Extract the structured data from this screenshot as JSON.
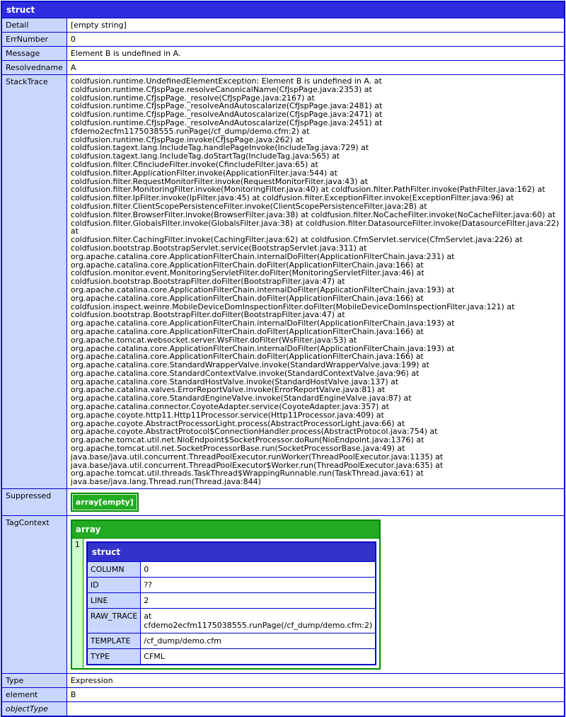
{
  "struct": {
    "title": "struct",
    "rows": {
      "detail": {
        "key": "Detail",
        "value": "[empty string]"
      },
      "errnumber": {
        "key": "ErrNumber",
        "value": "0"
      },
      "message": {
        "key": "Message",
        "value": "Element B is undefined in A."
      },
      "resolvedname": {
        "key": "Resolvedname",
        "value": "A"
      },
      "stacktrace": {
        "key": "StackTrace"
      },
      "suppressed": {
        "key": "Suppressed",
        "value": "array[empty]"
      },
      "tagcontext": {
        "key": "TagContext"
      },
      "type": {
        "key": "Type",
        "value": "Expression"
      },
      "element": {
        "key": "element",
        "value": "B"
      },
      "objecttype": {
        "key": "objectType"
      }
    },
    "stacktrace_lines": [
      "coldfusion.runtime.UndefinedElementException: Element B is undefined in A. at",
      "coldfusion.runtime.CfJspPage.resolveCanonicalName(CfJspPage.java:2353) at coldfusion.runtime.CfJspPage._resolve(CfJspPage.java:2167) at",
      "coldfusion.runtime.CfJspPage._resolveAndAutoscalarize(CfJspPage.java:2481) at",
      "coldfusion.runtime.CfJspPage._resolveAndAutoscalarize(CfJspPage.java:2471) at",
      "coldfusion.runtime.CfJspPage._resolveAndAutoscalarize(CfJspPage.java:2451) at cfdemo2ecfm1175038555.runPage(/cf_dump/demo.cfm:2) at",
      "coldfusion.runtime.CfJspPage.invoke(CfJspPage.java:262) at coldfusion.tagext.lang.IncludeTag.handlePageInvoke(IncludeTag.java:729) at",
      "coldfusion.tagext.lang.IncludeTag.doStartTag(IncludeTag.java:565) at coldfusion.filter.CfincludeFilter.invoke(CfincludeFilter.java:65) at",
      "coldfusion.filter.ApplicationFilter.invoke(ApplicationFilter.java:544) at coldfusion.filter.RequestMonitorFilter.invoke(RequestMonitorFilter.java:43) at",
      "coldfusion.filter.MonitoringFilter.invoke(MonitoringFilter.java:40) at coldfusion.filter.PathFilter.invoke(PathFilter.java:162) at",
      "coldfusion.filter.IpFilter.invoke(IpFilter.java:45) at coldfusion.filter.ExceptionFilter.invoke(ExceptionFilter.java:96) at",
      "coldfusion.filter.ClientScopePersistenceFilter.invoke(ClientScopePersistenceFilter.java:28) at",
      "coldfusion.filter.BrowserFilter.invoke(BrowserFilter.java:38) at coldfusion.filter.NoCacheFilter.invoke(NoCacheFilter.java:60) at",
      "coldfusion.filter.GlobalsFilter.invoke(GlobalsFilter.java:38) at coldfusion.filter.DatasourceFilter.invoke(DatasourceFilter.java:22) at",
      "coldfusion.filter.CachingFilter.invoke(CachingFilter.java:62) at coldfusion.CfmServlet.service(CfmServlet.java:226) at",
      "coldfusion.bootstrap.BootstrapServlet.service(BootstrapServlet.java:311) at",
      "org.apache.catalina.core.ApplicationFilterChain.internalDoFilter(ApplicationFilterChain.java:231) at",
      "org.apache.catalina.core.ApplicationFilterChain.doFilter(ApplicationFilterChain.java:166) at",
      "coldfusion.monitor.event.MonitoringServletFilter.doFilter(MonitoringServletFilter.java:46) at",
      "coldfusion.bootstrap.BootstrapFilter.doFilter(BootstrapFilter.java:47) at",
      "org.apache.catalina.core.ApplicationFilterChain.internalDoFilter(ApplicationFilterChain.java:193) at",
      "org.apache.catalina.core.ApplicationFilterChain.doFilter(ApplicationFilterChain.java:166) at",
      "coldfusion.inspect.weinre.MobileDeviceDomInspectionFilter.doFilter(MobileDeviceDomInspectionFilter.java:121) at",
      "coldfusion.bootstrap.BootstrapFilter.doFilter(BootstrapFilter.java:47) at",
      "org.apache.catalina.core.ApplicationFilterChain.internalDoFilter(ApplicationFilterChain.java:193) at",
      "org.apache.catalina.core.ApplicationFilterChain.doFilter(ApplicationFilterChain.java:166) at",
      "org.apache.tomcat.websocket.server.WsFilter.doFilter(WsFilter.java:53) at",
      "org.apache.catalina.core.ApplicationFilterChain.internalDoFilter(ApplicationFilterChain.java:193) at",
      "org.apache.catalina.core.ApplicationFilterChain.doFilter(ApplicationFilterChain.java:166) at",
      "org.apache.catalina.core.StandardWrapperValve.invoke(StandardWrapperValve.java:199) at",
      "org.apache.catalina.core.StandardContextValve.invoke(StandardContextValve.java:96) at",
      "org.apache.catalina.core.StandardHostValve.invoke(StandardHostValve.java:137) at",
      "org.apache.catalina.valves.ErrorReportValve.invoke(ErrorReportValve.java:81) at",
      "org.apache.catalina.core.StandardEngineValve.invoke(StandardEngineValve.java:87) at",
      "org.apache.catalina.connector.CoyoteAdapter.service(CoyoteAdapter.java:357) at",
      "org.apache.coyote.http11.Http11Processor.service(Http11Processor.java:409) at",
      "org.apache.coyote.AbstractProcessorLight.process(AbstractProcessorLight.java:66) at",
      "org.apache.coyote.AbstractProtocol$ConnectionHandler.process(AbstractProtocol.java:754) at",
      "org.apache.tomcat.util.net.NioEndpoint$SocketProcessor.doRun(NioEndpoint.java:1376) at",
      "org.apache.tomcat.util.net.SocketProcessorBase.run(SocketProcessorBase.java:49) at",
      "java.base/java.util.concurrent.ThreadPoolExecutor.runWorker(ThreadPoolExecutor.java:1135) at",
      "java.base/java.util.concurrent.ThreadPoolExecutor$Worker.run(ThreadPoolExecutor.java:635) at",
      "org.apache.tomcat.util.threads.TaskThread$WrappingRunnable.run(TaskThread.java:61) at java.base/java.lang.Thread.run(Thread.java:844)"
    ],
    "tagcontext": {
      "array_title": "array",
      "index": "1",
      "struct_title": "struct",
      "rows": [
        {
          "key": "COLUMN",
          "value": "0"
        },
        {
          "key": "ID",
          "value": "??"
        },
        {
          "key": "LINE",
          "value": "2"
        },
        {
          "key": "RAW_TRACE",
          "value": "at cfdemo2ecfm1175038555.runPage(/cf_dump/demo.cfm:2)"
        },
        {
          "key": "TEMPLATE",
          "value": "/cf_dump/demo.cfm"
        },
        {
          "key": "TYPE",
          "value": "CFML"
        }
      ]
    }
  }
}
